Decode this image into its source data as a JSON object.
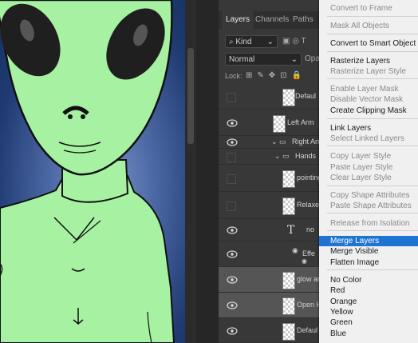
{
  "panel": {
    "tabs": [
      {
        "label": "Layers",
        "active": true
      },
      {
        "label": "Channels",
        "active": false
      },
      {
        "label": "Paths",
        "active": false
      }
    ],
    "filter_label": "Kind",
    "blend_mode": "Normal",
    "opacity_label": "Opac",
    "lock_label": "Lock:",
    "layers": [
      {
        "name": "Defaul",
        "visible": false,
        "selected": false,
        "kind": "smart"
      },
      {
        "name": "Left Arm",
        "visible": true,
        "selected": false,
        "kind": "smart"
      },
      {
        "name": "Right Arm",
        "visible": true,
        "selected": false,
        "kind": "group"
      },
      {
        "name": "Hands",
        "visible": false,
        "selected": false,
        "kind": "group"
      },
      {
        "name": "pointing",
        "visible": false,
        "selected": false,
        "kind": "smart"
      },
      {
        "name": "Relaxed",
        "visible": false,
        "selected": false,
        "kind": "smart"
      },
      {
        "name": "no",
        "visible": true,
        "selected": false,
        "kind": "text"
      },
      {
        "name": "Effe",
        "visible": true,
        "selected": false,
        "kind": "effects"
      },
      {
        "name": "glow ar",
        "visible": true,
        "selected": true,
        "kind": "smart"
      },
      {
        "name": "Open H",
        "visible": true,
        "selected": true,
        "kind": "smart"
      },
      {
        "name": "Defaul",
        "visible": true,
        "selected": false,
        "kind": "smart"
      }
    ]
  },
  "menu": {
    "items": [
      {
        "label": "Convert to Frame",
        "disabled": true
      },
      {
        "label": "Mask All Objects",
        "disabled": true
      },
      {
        "label": "Convert to Smart Object",
        "disabled": false
      },
      {
        "label": "Rasterize Layers",
        "disabled": false
      },
      {
        "label": "Rasterize Layer Style",
        "disabled": true
      },
      {
        "label": "Enable Layer Mask",
        "disabled": true
      },
      {
        "label": "Disable Vector Mask",
        "disabled": true
      },
      {
        "label": "Create Clipping Mask",
        "disabled": false
      },
      {
        "label": "Link Layers",
        "disabled": false
      },
      {
        "label": "Select Linked Layers",
        "disabled": true
      },
      {
        "label": "Copy Layer Style",
        "disabled": true
      },
      {
        "label": "Paste Layer Style",
        "disabled": true
      },
      {
        "label": "Clear Layer Style",
        "disabled": true
      },
      {
        "label": "Copy Shape Attributes",
        "disabled": true
      },
      {
        "label": "Paste Shape Attributes",
        "disabled": true
      },
      {
        "label": "Release from Isolation",
        "disabled": true
      },
      {
        "label": "Merge Layers",
        "disabled": false,
        "highlighted": true
      },
      {
        "label": "Merge Visible",
        "disabled": false
      },
      {
        "label": "Flatten Image",
        "disabled": false
      },
      {
        "label": "No Color",
        "disabled": false
      },
      {
        "label": "Red",
        "disabled": false
      },
      {
        "label": "Orange",
        "disabled": false
      },
      {
        "label": "Yellow",
        "disabled": false
      },
      {
        "label": "Green",
        "disabled": false
      },
      {
        "label": "Blue",
        "disabled": false
      }
    ]
  },
  "colors": {
    "alien_skin": "#a6f2a2",
    "menu_highlight": "#1e75d1",
    "panel_bg": "#383838"
  }
}
